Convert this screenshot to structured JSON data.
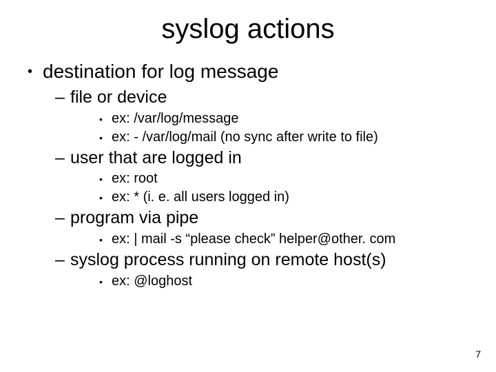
{
  "title": "syslog actions",
  "bullets": {
    "l1_0": "destination for log message",
    "l2_0": "file or device",
    "l3_0": "ex: /var/log/message",
    "l3_1": "ex: - /var/log/mail  (no sync after write to file)",
    "l2_1": "user that are logged in",
    "l3_2": "ex: root",
    "l3_3": "ex: *             (i. e. all users logged in)",
    "l2_2": "program via pipe",
    "l3_4": "ex: | mail -s “please check” helper@other. com",
    "l2_3": "syslog process running on remote host(s)",
    "l3_5": "ex: @loghost"
  },
  "page_number": "7"
}
